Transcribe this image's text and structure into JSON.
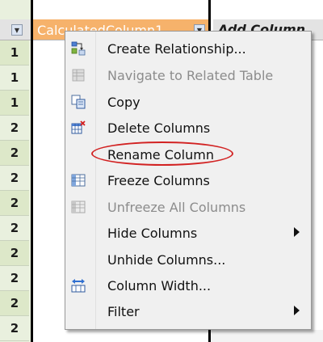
{
  "table": {
    "row_numbers": [
      "1",
      "1",
      "1",
      "2",
      "2",
      "2",
      "2",
      "2",
      "2",
      "2",
      "2",
      "2",
      "2"
    ],
    "calc_column_header": "CalculatedColumn1",
    "add_column_header": "Add Column"
  },
  "context_menu": {
    "items": [
      {
        "label": "Create Relationship...",
        "enabled": true,
        "icon": "create-relationship-icon",
        "submenu": false
      },
      {
        "label": "Navigate to Related Table",
        "enabled": false,
        "icon": "navigate-related-table-icon",
        "submenu": false
      },
      {
        "label": "Copy",
        "enabled": true,
        "icon": "copy-icon",
        "submenu": false
      },
      {
        "label": "Delete Columns",
        "enabled": true,
        "icon": "delete-columns-icon",
        "submenu": false
      },
      {
        "label": "Rename Column",
        "enabled": true,
        "icon": "",
        "submenu": false,
        "highlighted": true
      },
      {
        "label": "Freeze Columns",
        "enabled": true,
        "icon": "freeze-columns-icon",
        "submenu": false
      },
      {
        "label": "Unfreeze All Columns",
        "enabled": false,
        "icon": "unfreeze-columns-icon",
        "submenu": false
      },
      {
        "label": "Hide Columns",
        "enabled": true,
        "icon": "",
        "submenu": true
      },
      {
        "label": "Unhide Columns...",
        "enabled": true,
        "icon": "",
        "submenu": false
      },
      {
        "label": "Column Width...",
        "enabled": true,
        "icon": "column-width-icon",
        "submenu": false
      },
      {
        "label": "Filter",
        "enabled": true,
        "icon": "",
        "submenu": true
      }
    ]
  },
  "colors": {
    "highlight_ellipse": "#d22222",
    "calc_header_bg": "#f6b26b",
    "row_alt_bg": "#dde8c9"
  }
}
